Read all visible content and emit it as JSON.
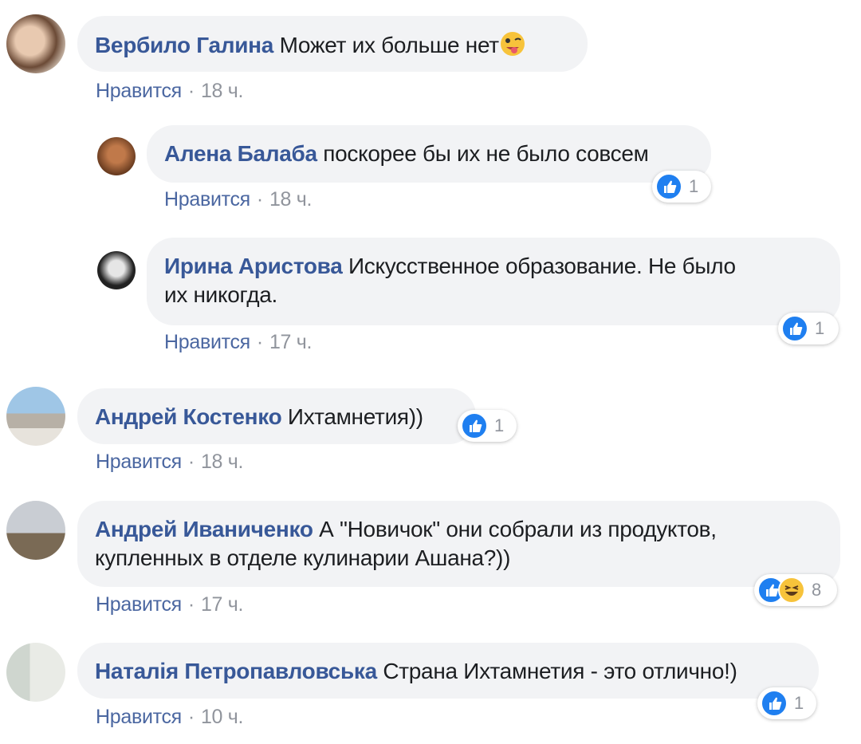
{
  "common": {
    "like_label": "Нравится",
    "separator": "·"
  },
  "comments": [
    {
      "author": "Вербило Галина",
      "text": "Может их больше нет",
      "time": "18 ч.",
      "emoji": "winking-tongue-emoji"
    },
    {
      "author": "Алена Балаба",
      "text": "поскорее бы их не было совсем",
      "time": "18 ч.",
      "reaction_count": "1"
    },
    {
      "author": "Ирина Аристова",
      "text": "Искусственное образование. Не было",
      "text2": "их никогда.",
      "time": "17 ч.",
      "reaction_count": "1"
    },
    {
      "author": "Андрей Костенко",
      "text": "Ихтамнетия))",
      "time": "18 ч.",
      "reaction_count": "1"
    },
    {
      "author": "Андрей Иваниченко",
      "text": "А \"Новичок\" они собрали из продуктов,",
      "text2": "купленных в отделе кулинарии Ашана?))",
      "time": "17 ч.",
      "reaction_count": "8"
    },
    {
      "author": "Наталія Петропавловська",
      "text": "Страна Ихтамнетия - это отлично!)",
      "time": "10 ч.",
      "reaction_count": "1"
    }
  ],
  "icons": {
    "like": "like-thumb-icon",
    "haha": "haha-icon"
  },
  "colors": {
    "name": "#385898",
    "bubble": "#f2f3f5",
    "meta": "#90949c",
    "like_blue": "#1f7ff0"
  }
}
